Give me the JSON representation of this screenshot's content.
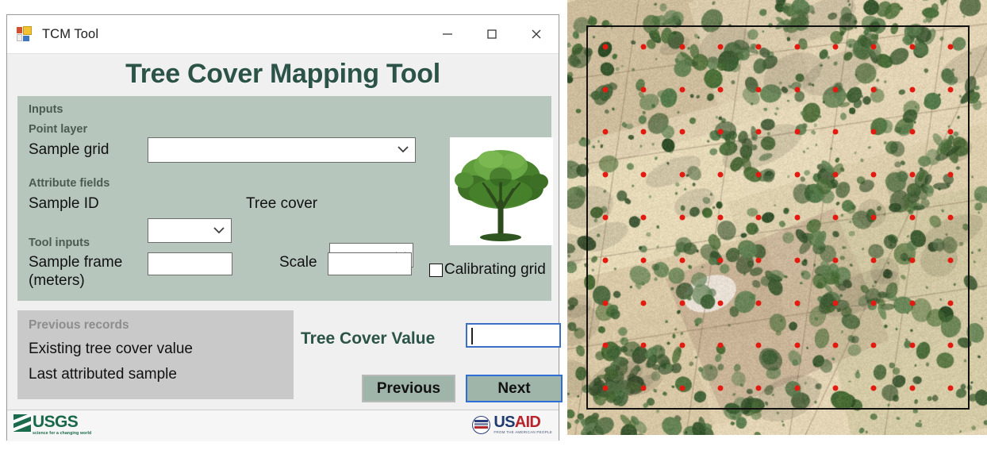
{
  "window": {
    "title": "TCM Tool",
    "icon": "app-icon",
    "controls": [
      {
        "name": "minimize",
        "glyph": "minimize-icon"
      },
      {
        "name": "maximize",
        "glyph": "maximize-icon"
      },
      {
        "name": "close",
        "glyph": "close-icon"
      }
    ]
  },
  "heading": "Tree Cover Mapping Tool",
  "inputs": {
    "group_label": "Inputs",
    "point_layer_label": "Point layer",
    "sample_grid_label": "Sample grid",
    "sample_grid_value": "",
    "sample_grid_placeholder": "",
    "attribute_fields_label": "Attribute fields",
    "sample_id_label": "Sample ID",
    "sample_id_value": "",
    "tree_cover_label": "Tree cover",
    "tree_cover_value": "",
    "tool_inputs_label": "Tool inputs",
    "sample_frame_label": "Sample frame\n(meters)",
    "sample_frame_label_line1": "Sample frame",
    "sample_frame_label_line2": "(meters)",
    "sample_frame_value": "",
    "scale_label": "Scale",
    "scale_value": "",
    "calibrating_grid_label": "Calibrating grid",
    "calibrating_grid_checked": false,
    "tree_photo_alt": "tree-photo"
  },
  "previous_records": {
    "title": "Previous records",
    "lines": [
      "Existing tree cover value",
      "Last attributed sample"
    ]
  },
  "entry": {
    "tree_cover_value_label": "Tree Cover Value",
    "tree_cover_value_input": "",
    "previous_button": "Previous",
    "next_button": "Next"
  },
  "footer": {
    "usgs_name": "USGS",
    "usgs_tagline": "science for a changing world",
    "usaid_us": "US",
    "usaid_aid": "AID",
    "usaid_tagline": "FROM THE AMERICAN PEOPLE"
  },
  "colors": {
    "heading_green": "#2c5347",
    "panel_green": "#b6c6bd",
    "button_green": "#9fb5a9",
    "focus_blue": "#2f6ed4",
    "records_gray": "#c9c9c9",
    "usgs_green": "#18684a",
    "usaid_blue": "#1f3a6e",
    "usaid_red": "#b9232b",
    "sample_point_red": "#e21a0f",
    "frame_black": "#111111"
  },
  "satellite": {
    "name": "satellite-imagery",
    "frame_label": "sample-frame",
    "point_grid": {
      "columns": 10,
      "rows": 9,
      "point_color": "#e21a0f",
      "point_radius_px": 3.5
    },
    "seed": 20240607
  }
}
